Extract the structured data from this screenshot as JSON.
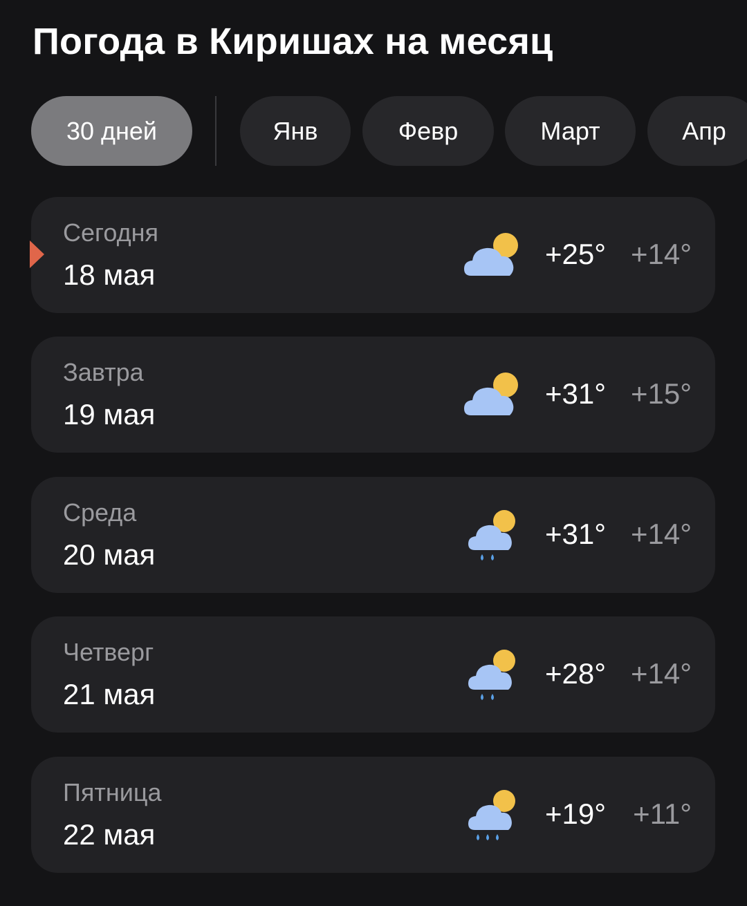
{
  "header": {
    "title": "Погода в Киришах на месяц"
  },
  "tabs": [
    {
      "label": "30 дней",
      "active": true
    },
    {
      "label": "Янв",
      "active": false
    },
    {
      "label": "Февр",
      "active": false
    },
    {
      "label": "Март",
      "active": false
    },
    {
      "label": "Апр",
      "active": false
    }
  ],
  "days": [
    {
      "name": "Сегодня",
      "date": "18 мая",
      "icon": "partly-cloudy-icon",
      "temp_max": "+25°",
      "temp_min": "+14°",
      "is_today": true
    },
    {
      "name": "Завтра",
      "date": "19 мая",
      "icon": "partly-cloudy-icon",
      "temp_max": "+31°",
      "temp_min": "+15°",
      "is_today": false
    },
    {
      "name": "Среда",
      "date": "20 мая",
      "icon": "light-rain-icon",
      "temp_max": "+31°",
      "temp_min": "+14°",
      "is_today": false
    },
    {
      "name": "Четверг",
      "date": "21 мая",
      "icon": "light-rain-icon",
      "temp_max": "+28°",
      "temp_min": "+14°",
      "is_today": false
    },
    {
      "name": "Пятница",
      "date": "22 мая",
      "icon": "rain-icon",
      "temp_max": "+19°",
      "temp_min": "+11°",
      "is_today": false
    }
  ],
  "colors": {
    "background": "#141416",
    "card": "#222225",
    "tab": "#27272a",
    "tab_active": "#7b7b7e",
    "today_marker": "#e0664a",
    "sun": "#f2c14a",
    "cloud": "#a7c5f5",
    "rain_drop": "#5aa0e6"
  }
}
